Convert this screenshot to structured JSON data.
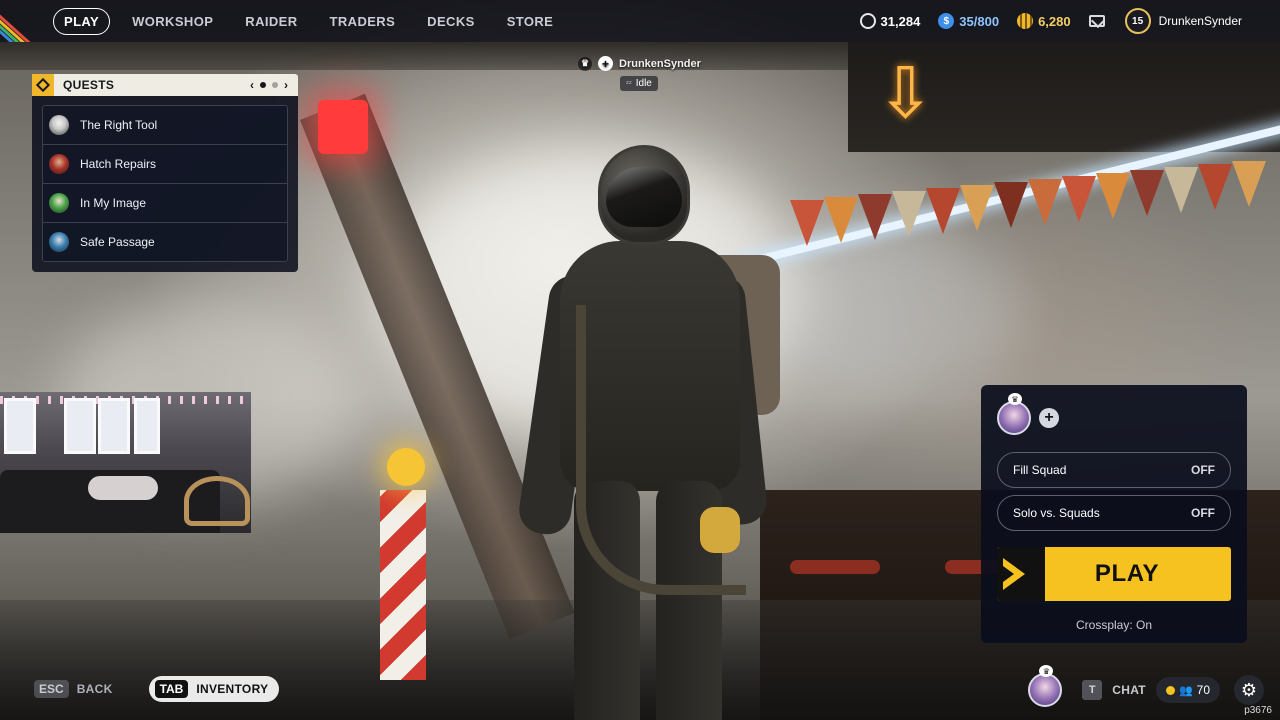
{
  "nav": {
    "items": [
      {
        "label": "PLAY",
        "active": true
      },
      {
        "label": "WORKSHOP"
      },
      {
        "label": "RAIDER"
      },
      {
        "label": "TRADERS"
      },
      {
        "label": "DECKS"
      },
      {
        "label": "STORE"
      }
    ]
  },
  "currencies": {
    "raider_tokens": {
      "value": "31,284",
      "icon": "token-icon",
      "color": "#e6e7ea"
    },
    "capacity": {
      "value": "35/800",
      "icon": "credits-icon",
      "color": "#5aa9ff"
    },
    "coins": {
      "value": "6,280",
      "icon": "coins-icon",
      "color": "#f0b72a"
    }
  },
  "user": {
    "level": "15",
    "name": "DrunkenSynder"
  },
  "player_tag": {
    "name": "DrunkenSynder",
    "status": "Idle"
  },
  "quests": {
    "title": "QUESTS",
    "page": 1,
    "page_count": 3,
    "items": [
      {
        "label": "The Right Tool",
        "avatar_color": "#c9c9c9"
      },
      {
        "label": "Hatch Repairs",
        "avatar_color": "#a8342c"
      },
      {
        "label": "In My Image",
        "avatar_color": "#4aa24a"
      },
      {
        "label": "Safe Passage",
        "avatar_color": "#3a7fb0"
      }
    ]
  },
  "squad": {
    "fill_squad": {
      "label": "Fill Squad",
      "state": "OFF"
    },
    "solo_vs_squads": {
      "label": "Solo vs. Squads",
      "state": "OFF"
    },
    "play_label": "PLAY",
    "crossplay": "Crossplay: On"
  },
  "footer": {
    "back_key": "ESC",
    "back_label": "BACK",
    "inventory_key": "TAB",
    "inventory_label": "INVENTORY",
    "chat_key": "T",
    "chat_label": "CHAT",
    "online_count": "70",
    "build": "p3676"
  },
  "colors": {
    "accent": "#f5c21f",
    "panel": "#0a0d1c"
  }
}
